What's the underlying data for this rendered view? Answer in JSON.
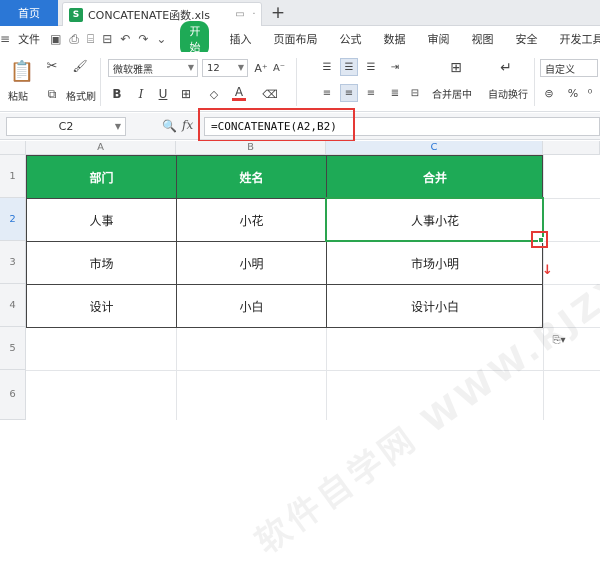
{
  "tabs": {
    "home": "首页",
    "file": "CONCATENATE函数.xls",
    "add": "+"
  },
  "menubar": {
    "file_menu": "文件",
    "start": "开始",
    "items": [
      "插入",
      "页面布局",
      "公式",
      "数据",
      "审阅",
      "视图",
      "安全",
      "开发工具"
    ]
  },
  "ribbon": {
    "paste": "粘贴",
    "format_painter": "格式刷",
    "font_name": "微软雅黑",
    "font_size": "12",
    "merge_center": "合并居中",
    "wrap_text": "自动换行",
    "number_format": "自定义",
    "bold": "B",
    "italic": "I",
    "underline": "U",
    "font_color_letter": "A"
  },
  "formula_bar": {
    "name_box": "C2",
    "fx": "fx",
    "formula": "=CONCATENATE(A2,B2)"
  },
  "grid": {
    "columns": [
      "A",
      "B",
      "C"
    ],
    "rows": [
      "1",
      "2",
      "3",
      "4",
      "5",
      "6"
    ],
    "header": [
      "部门",
      "姓名",
      "合并"
    ],
    "data": [
      [
        "人事",
        "小花",
        "人事小花"
      ],
      [
        "市场",
        "小明",
        "市场小明"
      ],
      [
        "设计",
        "小白",
        "设计小白"
      ]
    ]
  },
  "watermark": "软件自学网 WWW.RJZXW.COM",
  "colors": {
    "accent_blue": "#2b77d6",
    "header_green": "#1eaa56",
    "selection_green": "#2aa54f",
    "highlight_red": "#e53935"
  }
}
